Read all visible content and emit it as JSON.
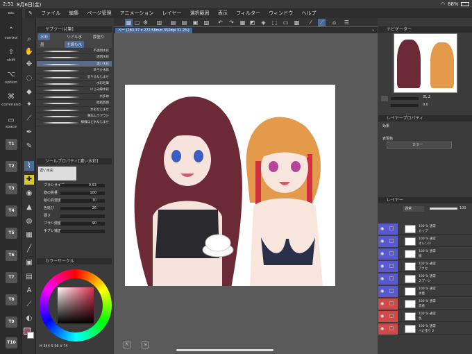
{
  "status": {
    "time": "2:51",
    "date": "8月6日(金)",
    "battery": "88%"
  },
  "menu": [
    "ファイル",
    "編集",
    "ページ管理",
    "アニメーション",
    "レイヤー",
    "選択範囲",
    "表示",
    "フィルター",
    "ウィンドウ",
    "ヘルプ"
  ],
  "left_shortcuts": {
    "esc": "esc",
    "control": "control",
    "shift": "shift",
    "option": "option",
    "command": "command",
    "space": "space",
    "t_buttons": [
      "T1",
      "T2",
      "T3",
      "T4",
      "T5",
      "T6",
      "T7",
      "T8",
      "T9",
      "T10"
    ]
  },
  "sub_tool": {
    "header": "サブツール[筆]",
    "tabs": [
      "水彩",
      "リアル水",
      "厚塗り",
      "墨",
      "主線も水"
    ],
    "brushes": [
      "不透明水彩",
      "透明水彩",
      "濃い水彩",
      "滲ろか水彩",
      "塗りるなじませ",
      "水彩毛筆",
      "にじみ縁水彩",
      "水多め",
      "絵肌質感",
      "水彩なじませ",
      "重ねムラブラシ",
      "線線ほど水なじませ"
    ],
    "selected_index": 2
  },
  "tool_property": {
    "header": "ツールプロパティ[濃い水彩]",
    "preset": "濃い水彩",
    "rows": [
      {
        "label": "ブラシサイズ",
        "value": "0.53"
      },
      {
        "label": "筋の質量",
        "value": "100"
      },
      {
        "label": "絵の具濃度",
        "value": "70"
      },
      {
        "label": "色延び",
        "value": "26"
      },
      {
        "label": "硬さ",
        "value": ""
      },
      {
        "label": "ブラシ濃度",
        "value": "90"
      },
      {
        "label": "手ブレ補正",
        "value": ""
      }
    ]
  },
  "color_panel": {
    "header": "カラーサークル",
    "readout": "H 344 S 56 V 74"
  },
  "canvas": {
    "tab_title": "ペー (283.17 x 272.58mm 350dpi 31.2%)"
  },
  "navigator": {
    "header": "ナビゲーター",
    "zoom": "31.2",
    "rotate": "0.0"
  },
  "layer_property": {
    "header": "レイヤープロパティ",
    "effect_label": "効果",
    "expression_label": "表現色",
    "expression_value": "カラー"
  },
  "layers": {
    "header": "レイヤー",
    "blend": "通常",
    "opacity": "100",
    "rows": [
      {
        "pct": "100 % 通常",
        "name": "カップ"
      },
      {
        "pct": "100 % 通常",
        "name": "オレンジ"
      },
      {
        "pct": "100 % 通常",
        "name": "服"
      },
      {
        "pct": "100 % 通常",
        "name": "アクセ"
      },
      {
        "pct": "100 % 通常",
        "name": "スプーン"
      },
      {
        "pct": "100 % 通常",
        "name": "水着"
      },
      {
        "pct": "100 % 通常",
        "name": "志希"
      },
      {
        "pct": "100 % 通常",
        "name": "色"
      },
      {
        "pct": "100 % 通常",
        "name": "べた塗り 2"
      }
    ]
  },
  "colors": {
    "accent": "#4a6a9a",
    "selected_brush": "#5a6b87"
  }
}
